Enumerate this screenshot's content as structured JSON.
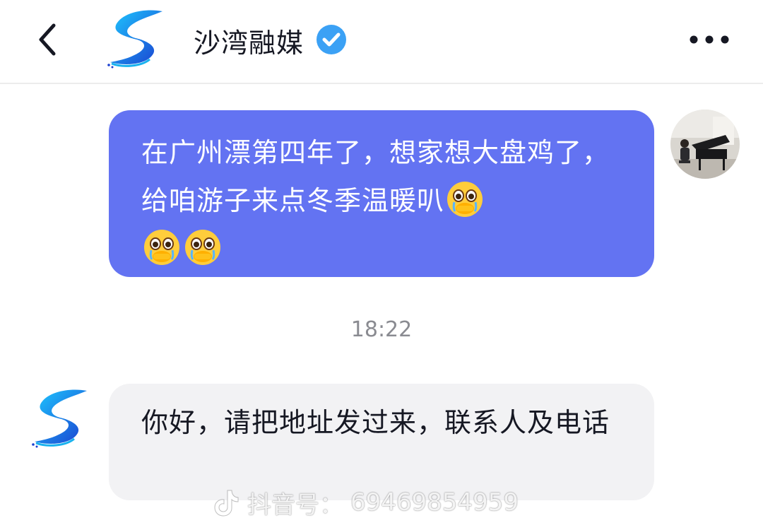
{
  "header": {
    "account_name": "沙湾融媒",
    "icons": {
      "back": "chevron-left-icon",
      "verified": "verified-badge-icon",
      "more": "more-dots-icon"
    },
    "verified_color": "#3ba1f5"
  },
  "messages": [
    {
      "direction": "outgoing",
      "text": "在广州漂第四年了，想家想大盘鸡了，给咱游子来点冬季温暖叭",
      "trailing_emoji": [
        "teary-face-emoji",
        "teary-face-emoji",
        "teary-face-emoji"
      ],
      "bubble_color": "#6373f2"
    },
    {
      "direction": "incoming",
      "text": "你好，请把地址发过来，联系人及电话",
      "bubble_color": "#f2f2f4"
    }
  ],
  "timestamp": "18:22",
  "watermark": {
    "label": "抖音号：",
    "id": "69469854959"
  }
}
